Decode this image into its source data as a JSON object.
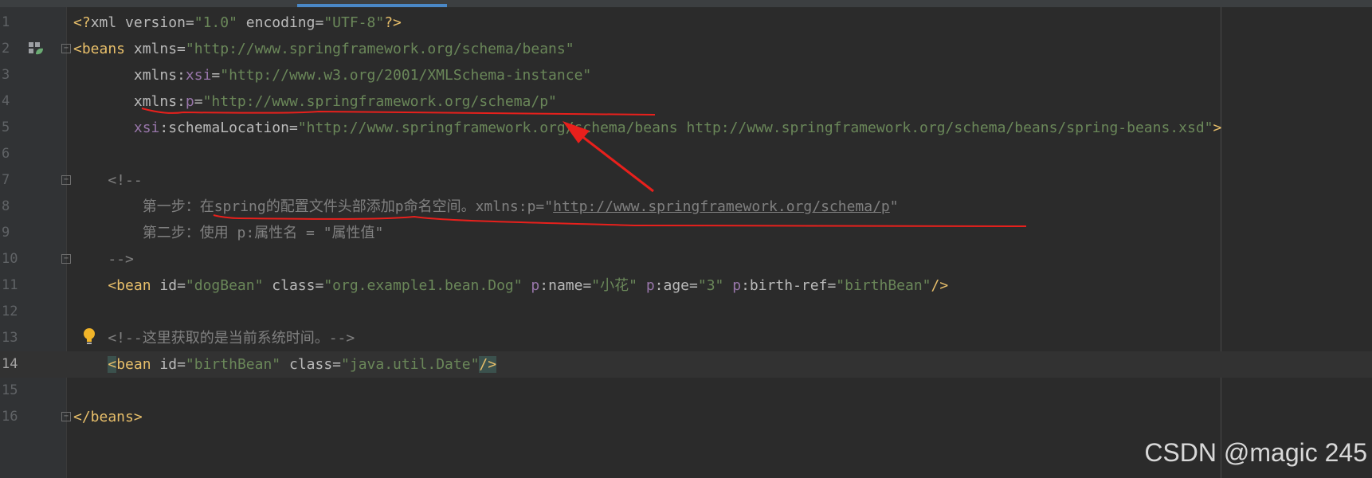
{
  "editor": {
    "active_line": 14,
    "lines": [
      {
        "num": "1",
        "tokens": [
          [
            "<?",
            "p"
          ],
          [
            "xml ",
            "a"
          ],
          [
            "version",
            "a"
          ],
          [
            "=",
            "a"
          ],
          [
            "\"1.0\"",
            "s"
          ],
          [
            " encoding",
            "a"
          ],
          [
            "=",
            "a"
          ],
          [
            "\"UTF-8\"",
            "s"
          ],
          [
            "?>",
            "p"
          ]
        ]
      },
      {
        "num": "2",
        "tokens": [
          [
            "<beans ",
            "p"
          ],
          [
            "xmlns",
            "a"
          ],
          [
            "=",
            "a"
          ],
          [
            "\"http://www.springframework.org/schema/beans\"",
            "s"
          ]
        ]
      },
      {
        "num": "3",
        "tokens": [
          [
            "       xmlns",
            "a"
          ],
          [
            ":",
            "a"
          ],
          [
            "xsi",
            "ns"
          ],
          [
            "=",
            "a"
          ],
          [
            "\"http://www.w3.org/2001/XMLSchema-instance\"",
            "s"
          ]
        ]
      },
      {
        "num": "4",
        "tokens": [
          [
            "       xmlns",
            "a"
          ],
          [
            ":",
            "a"
          ],
          [
            "p",
            "ns"
          ],
          [
            "=",
            "a"
          ],
          [
            "\"http://www.springframework.org/schema/p\"",
            "s"
          ]
        ]
      },
      {
        "num": "5",
        "tokens": [
          [
            "       ",
            "a"
          ],
          [
            "xsi",
            "ns"
          ],
          [
            ":schemaLocation",
            "a"
          ],
          [
            "=",
            "a"
          ],
          [
            "\"http://www.springframework.org/schema/beans http://www.springframework.org/schema/beans/spring-beans.xsd\"",
            "s"
          ],
          [
            ">",
            "p"
          ]
        ]
      },
      {
        "num": "6",
        "tokens": []
      },
      {
        "num": "7",
        "tokens": [
          [
            "    <!--",
            "c"
          ]
        ]
      },
      {
        "num": "8",
        "tokens": [
          [
            "        第一步：在",
            "c"
          ],
          [
            "spring",
            "c"
          ],
          [
            "的配置文件头部添加",
            "c"
          ],
          [
            "p",
            "c"
          ],
          [
            "命名空间。xmlns:p=\"",
            "c"
          ],
          [
            "http://www.springframework.org/schema/p",
            "u"
          ],
          [
            "\"",
            "c"
          ]
        ]
      },
      {
        "num": "9",
        "tokens": [
          [
            "        第二步：使用 p:属性名 = \"属性值\"",
            "c"
          ]
        ]
      },
      {
        "num": "10",
        "tokens": [
          [
            "    -->",
            "c"
          ]
        ]
      },
      {
        "num": "11",
        "tokens": [
          [
            "    <bean ",
            "p"
          ],
          [
            "id",
            "a"
          ],
          [
            "=",
            "a"
          ],
          [
            "\"dogBean\"",
            "s"
          ],
          [
            " class",
            "a"
          ],
          [
            "=",
            "a"
          ],
          [
            "\"org.example1.bean.Dog\"",
            "s"
          ],
          [
            " ",
            "a"
          ],
          [
            "p",
            "ns"
          ],
          [
            ":name",
            "a"
          ],
          [
            "=",
            "a"
          ],
          [
            "\"小花\"",
            "s"
          ],
          [
            " ",
            "a"
          ],
          [
            "p",
            "ns"
          ],
          [
            ":age",
            "a"
          ],
          [
            "=",
            "a"
          ],
          [
            "\"3\"",
            "s"
          ],
          [
            " ",
            "a"
          ],
          [
            "p",
            "ns"
          ],
          [
            ":birth-ref",
            "a"
          ],
          [
            "=",
            "a"
          ],
          [
            "\"birthBean\"",
            "s"
          ],
          [
            "/>",
            "p"
          ]
        ]
      },
      {
        "num": "12",
        "tokens": []
      },
      {
        "num": "13",
        "tokens": [
          [
            "    <!--这里获取的是当前系统时间。-->",
            "c"
          ]
        ]
      },
      {
        "num": "14",
        "tokens": [
          [
            "    ",
            "a"
          ],
          [
            "<",
            "p"
          ],
          [
            "bean ",
            "p"
          ],
          [
            "id",
            "a"
          ],
          [
            "=",
            "a"
          ],
          [
            "\"birthBean\"",
            "s"
          ],
          [
            " class",
            "a"
          ],
          [
            "=",
            "a"
          ],
          [
            "\"java.util.Date\"",
            "s"
          ],
          [
            "/>",
            "p"
          ]
        ]
      },
      {
        "num": "15",
        "tokens": []
      },
      {
        "num": "16",
        "tokens": [
          [
            "</beans>",
            "p"
          ]
        ]
      }
    ]
  },
  "gutter": {
    "fold_markers": [
      "2",
      "7",
      "10",
      "16"
    ],
    "bean_icon_line": "2",
    "bulb_line": "13"
  },
  "annotation": {
    "color": "#e8201c"
  },
  "watermark": {
    "text": "CSDN @magic 245"
  },
  "colors": {
    "background": "#2b2b2b",
    "gutter": "#313335",
    "tag": "#e8bf6a",
    "attribute": "#bababa",
    "namespace": "#9876aa",
    "string": "#6a8759",
    "comment": "#808080"
  }
}
